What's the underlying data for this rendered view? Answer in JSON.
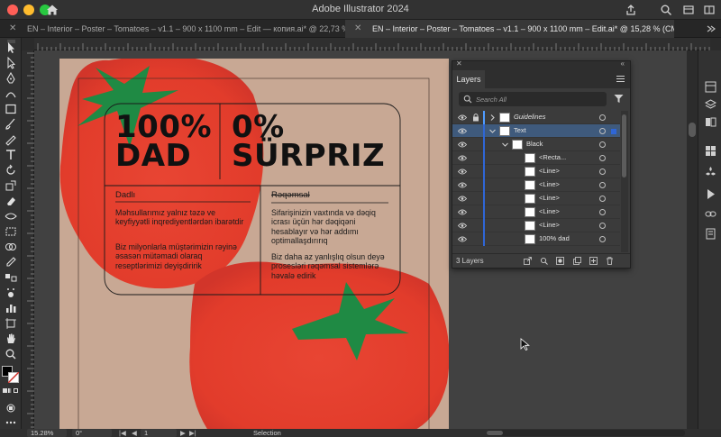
{
  "app": {
    "title": "Adobe Illustrator 2024"
  },
  "document_tabs": [
    {
      "label": "EN – Interior – Poster – Tomatoes – v1.1 – 900 x 1100 mm – Edit — копия.ai* @ 22,73 % (C...",
      "active": false
    },
    {
      "label": "EN – Interior – Poster – Tomatoes – v1.1 – 900 x 1100 mm – Edit.ai* @ 15,28 % (CMYK/Preview)",
      "active": true
    }
  ],
  "artwork": {
    "headline_left": [
      "100%",
      "DAD"
    ],
    "headline_right": [
      "0%",
      "SÜRPRIZ"
    ],
    "label_left": "Dadlı",
    "label_right": "Rəqəmsal",
    "para_left_1": "Məhsullarımız yalnız təzə ve keyfiyyətli inqrediyentlərdən ibarətdir",
    "para_left_2": "Biz milyonlarla müştərimizin rəyinə əsasən mütəmadi olaraq reseptlərimizi deyişdiririk",
    "para_right_1": "Sifarişinizin vaxtında və dəqiq icrası üçün hər dəqiqəni hesablayır və hər addımı optimallaşdırırıq",
    "para_right_2": "Biz daha az yanlışlıq olsun deyə prosesləri rəqəmsal sistemlərə həvalə edirik",
    "colors": {
      "background": "#c8a894",
      "tomato": "#e8402f",
      "leaf": "#1f8a44",
      "text": "#111111"
    }
  },
  "layers_panel": {
    "tab": "Layers",
    "search_placeholder": "Search All",
    "rows": [
      {
        "name": "Guidelines",
        "italic": true,
        "level": 0,
        "expandable": true,
        "expanded": false,
        "locked": true,
        "selected": false
      },
      {
        "name": "Text",
        "italic": false,
        "level": 0,
        "expandable": true,
        "expanded": true,
        "locked": false,
        "selected": true
      },
      {
        "name": "Black",
        "italic": false,
        "level": 1,
        "expandable": true,
        "expanded": true,
        "locked": false,
        "selected": false
      },
      {
        "name": "<Recta...",
        "italic": false,
        "level": 2,
        "expandable": false,
        "expanded": false,
        "locked": false,
        "selected": false
      },
      {
        "name": "<Line>",
        "italic": false,
        "level": 2,
        "expandable": false,
        "expanded": false,
        "locked": false,
        "selected": false
      },
      {
        "name": "<Line>",
        "italic": false,
        "level": 2,
        "expandable": false,
        "expanded": false,
        "locked": false,
        "selected": false
      },
      {
        "name": "<Line>",
        "italic": false,
        "level": 2,
        "expandable": false,
        "expanded": false,
        "locked": false,
        "selected": false
      },
      {
        "name": "<Line>",
        "italic": false,
        "level": 2,
        "expandable": false,
        "expanded": false,
        "locked": false,
        "selected": false
      },
      {
        "name": "<Line>",
        "italic": false,
        "level": 2,
        "expandable": false,
        "expanded": false,
        "locked": false,
        "selected": false
      },
      {
        "name": "100% dad",
        "italic": false,
        "level": 2,
        "expandable": false,
        "expanded": false,
        "locked": false,
        "selected": false
      }
    ],
    "footer_count": "3 Layers",
    "accent": "#2f66d6"
  },
  "statusbar": {
    "zoom": "15.28%",
    "rotation": "0°",
    "artboard": "1",
    "tool": "Selection"
  },
  "toolbar": {
    "tools": [
      "selection-tool",
      "direct-selection-tool",
      "pen-tool",
      "curvature-tool",
      "rectangle-tool",
      "paintbrush-tool",
      "pencil-tool",
      "type-tool",
      "rotate-tool",
      "scale-tool",
      "eraser-tool",
      "width-tool",
      "free-transform-tool",
      "shape-builder-tool",
      "mesh-tool",
      "gradient-tool",
      "eyedropper-tool",
      "blend-tool",
      "symbol-sprayer-tool",
      "column-graph-tool",
      "artboard-tool",
      "slice-tool",
      "hand-tool",
      "zoom-tool"
    ]
  }
}
